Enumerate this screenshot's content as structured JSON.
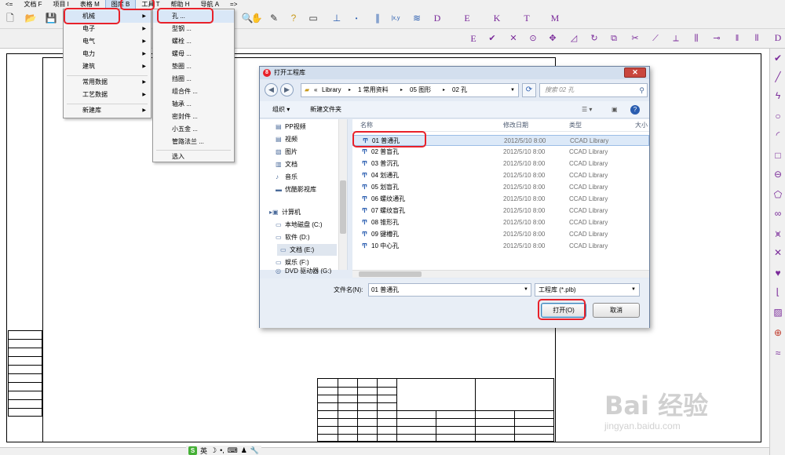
{
  "menubar": {
    "items": [
      {
        "label": "<="
      },
      {
        "label": "文档 F"
      },
      {
        "label": "项目 I"
      },
      {
        "label": "表格 M"
      },
      {
        "label": "图库 B"
      },
      {
        "label": "工具 T"
      },
      {
        "label": "帮助 H"
      },
      {
        "label": "导航 A"
      },
      {
        "label": "=>"
      }
    ]
  },
  "toolbar_letters": [
    "D",
    "E",
    "K",
    "T",
    "M"
  ],
  "toolbar2_letters": [
    "E"
  ],
  "right_letter": "D",
  "library_menu": {
    "items": [
      {
        "label": "机械",
        "has_submenu": true
      },
      {
        "label": "电子",
        "has_submenu": true
      },
      {
        "label": "电气",
        "has_submenu": true
      },
      {
        "label": "电力",
        "has_submenu": true
      },
      {
        "label": "建筑",
        "has_submenu": true
      },
      {
        "label": "常用数据",
        "has_submenu": true
      },
      {
        "label": "工艺数据",
        "has_submenu": true
      },
      {
        "label": "新建库",
        "has_submenu": true
      }
    ]
  },
  "mechanical_submenu": {
    "items": [
      {
        "label": "孔 ..."
      },
      {
        "label": "型钢 ..."
      },
      {
        "label": "螺栓 ..."
      },
      {
        "label": "螺母 ..."
      },
      {
        "label": "垫圈 ..."
      },
      {
        "label": "挡圈 ..."
      },
      {
        "label": "组合件 ..."
      },
      {
        "label": "轴承 ..."
      },
      {
        "label": "密封件 ..."
      },
      {
        "label": "小五金 ..."
      },
      {
        "label": "管路法兰 ..."
      },
      {
        "label": "选入"
      }
    ]
  },
  "dialog": {
    "title": "打开工程库",
    "address": [
      "«",
      "Library",
      "▸",
      "1 常用资料",
      "▸",
      "05 图形",
      "▸",
      "02 孔"
    ],
    "search_placeholder": "搜索 02 孔",
    "organize_label": "组织 ▾",
    "new_folder_label": "新建文件夹",
    "nav_items": [
      {
        "label": "PP视频",
        "icon": "video-icon"
      },
      {
        "label": "视频",
        "icon": "video-icon"
      },
      {
        "label": "图片",
        "icon": "picture-icon"
      },
      {
        "label": "文档",
        "icon": "document-icon"
      },
      {
        "label": "音乐",
        "icon": "music-icon"
      },
      {
        "label": "优酷影视库",
        "icon": "folder-icon"
      },
      {
        "label": "计算机",
        "icon": "computer-icon"
      },
      {
        "label": "本地磁盘 (C:)",
        "icon": "drive-icon"
      },
      {
        "label": "软件 (D:)",
        "icon": "drive-icon"
      },
      {
        "label": "文档 (E:)",
        "icon": "drive-icon"
      },
      {
        "label": "娱乐 (F:)",
        "icon": "drive-icon"
      },
      {
        "label": "DVD 驱动器 (G:)",
        "icon": "dvd-icon"
      }
    ],
    "columns": [
      "名称",
      "修改日期",
      "类型",
      "大小"
    ],
    "files": [
      {
        "name": "01 普通孔",
        "date": "2012/5/10 8:00",
        "type": "CCAD Library"
      },
      {
        "name": "02 普盲孔",
        "date": "2012/5/10 8:00",
        "type": "CCAD Library"
      },
      {
        "name": "03 普沉孔",
        "date": "2012/5/10 8:00",
        "type": "CCAD Library"
      },
      {
        "name": "04 划通孔",
        "date": "2012/5/10 8:00",
        "type": "CCAD Library"
      },
      {
        "name": "05 划盲孔",
        "date": "2012/5/10 8:00",
        "type": "CCAD Library"
      },
      {
        "name": "06 螺纹通孔",
        "date": "2012/5/10 8:00",
        "type": "CCAD Library"
      },
      {
        "name": "07 螺纹盲孔",
        "date": "2012/5/10 8:00",
        "type": "CCAD Library"
      },
      {
        "name": "08 锥形孔",
        "date": "2012/5/10 8:00",
        "type": "CCAD Library"
      },
      {
        "name": "09 键槽孔",
        "date": "2012/5/10 8:00",
        "type": "CCAD Library"
      },
      {
        "name": "10 中心孔",
        "date": "2012/5/10 8:00",
        "type": "CCAD Library"
      }
    ],
    "filename_label": "文件名(N):",
    "filename_value": "01 普通孔",
    "filetype_value": "工程库   (*.plb)",
    "open_label": "打开(O)",
    "cancel_label": "取消"
  },
  "ime": {
    "logo": "S",
    "label": "英"
  },
  "watermark": {
    "big": "Bai 经验",
    "small": "jingyan.baidu.com"
  }
}
